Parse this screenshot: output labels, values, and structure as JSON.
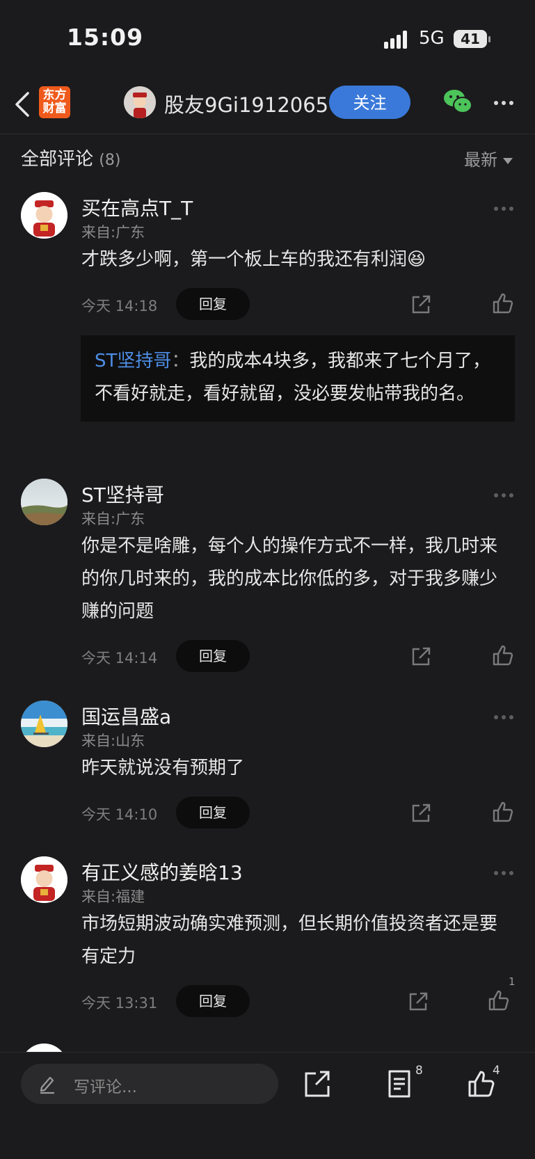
{
  "status": {
    "time": "15:09",
    "network": "5G",
    "battery": "41"
  },
  "header": {
    "logo_line1": "东方",
    "logo_line2": "财富",
    "title": "股友9Gi1912065",
    "follow_label": "关注"
  },
  "comments_header": {
    "title": "全部评论",
    "count": "(8)",
    "sort": "最新"
  },
  "comments": [
    {
      "user": "买在高点T_T",
      "location": "来自:广东",
      "text": "才跌多少啊，第一个板上车的我还有利润😆",
      "time": "今天 14:18",
      "reply_label": "回复",
      "quote": {
        "user": "ST坚持哥",
        "colon": "：",
        "text": "我的成本4块多，我都来了七个月了，不看好就走，看好就留，没必要发帖带我的名。"
      }
    },
    {
      "user": "ST坚持哥",
      "location": "来自:广东",
      "text": "你是不是啥雕，每个人的操作方式不一样，我几时来的你几时来的，我的成本比你低的多，对于我多赚少赚的问题",
      "time": "今天 14:14",
      "reply_label": "回复"
    },
    {
      "user": "国运昌盛a",
      "location": "来自:山东",
      "text": "昨天就说没有预期了",
      "time": "今天 14:10",
      "reply_label": "回复"
    },
    {
      "user": "有正义感的姜晗13",
      "location": "来自:福建",
      "text": "市场短期波动确实难预测，但长期价值投资者还是要有定力",
      "time": "今天 13:31",
      "reply_label": "回复",
      "likes": "1"
    }
  ],
  "bottom": {
    "placeholder": "写评论...",
    "comment_count": "8",
    "like_count": "4"
  },
  "colors": {
    "background": "#1b1b1d",
    "accent_blue": "#3a79d9",
    "link_blue": "#4d8ee6",
    "brand_orange": "#ef5a1c",
    "wechat_green": "#4cc45a"
  }
}
